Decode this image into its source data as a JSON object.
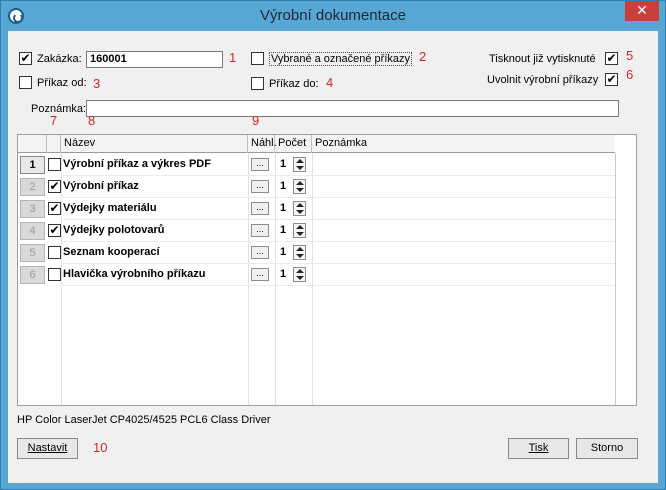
{
  "window": {
    "title": "Výrobní dokumentace",
    "close_glyph": "✕"
  },
  "filters": {
    "zakazka_label": "Zakázka:",
    "zakazka_checked": true,
    "zakazka_value": "160001",
    "prikaz_od_label": "Příkaz od:",
    "prikaz_od_checked": false,
    "vybrane_label": "Vybrané a označené příkazy",
    "vybrane_checked": false,
    "prikaz_do_label": "Příkaz do:",
    "prikaz_do_checked": false,
    "tisknout_label": "Tisknout již vytisknuté",
    "tisknout_checked": true,
    "uvolnit_label": "Uvolnit výrobní příkazy",
    "uvolnit_checked": true,
    "poznamka_label": "Poznámka:",
    "poznamka_value": ""
  },
  "annotations": {
    "n1": "1",
    "n2": "2",
    "n3": "3",
    "n4": "4",
    "n5": "5",
    "n6": "6",
    "n7": "7",
    "n8": "8",
    "n9": "9",
    "n10": "10"
  },
  "grid": {
    "headers": {
      "nazev": "Název",
      "nahl": "Náhl.",
      "pocet": "Počet",
      "poznamka": "Poznámka"
    },
    "rows": [
      {
        "num": "1",
        "checked": false,
        "name": "Výrobní příkaz a výkres PDF",
        "preview": "...",
        "count": "1",
        "note": ""
      },
      {
        "num": "2",
        "checked": true,
        "name": "Výrobní příkaz",
        "preview": "...",
        "count": "1",
        "note": ""
      },
      {
        "num": "3",
        "checked": true,
        "name": "Výdejky materiálu",
        "preview": "...",
        "count": "1",
        "note": ""
      },
      {
        "num": "4",
        "checked": true,
        "name": "Výdejky polotovarů",
        "preview": "...",
        "count": "1",
        "note": ""
      },
      {
        "num": "5",
        "checked": false,
        "name": "Seznam kooperací",
        "preview": "...",
        "count": "1",
        "note": ""
      },
      {
        "num": "6",
        "checked": false,
        "name": "Hlavička výrobního příkazu",
        "preview": "...",
        "count": "1",
        "note": ""
      }
    ]
  },
  "footer": {
    "printer": "HP Color LaserJet CP4025/4525 PCL6 Class Driver",
    "nastavit": "Nastavit",
    "tisk": "Tisk",
    "storno": "Storno"
  }
}
